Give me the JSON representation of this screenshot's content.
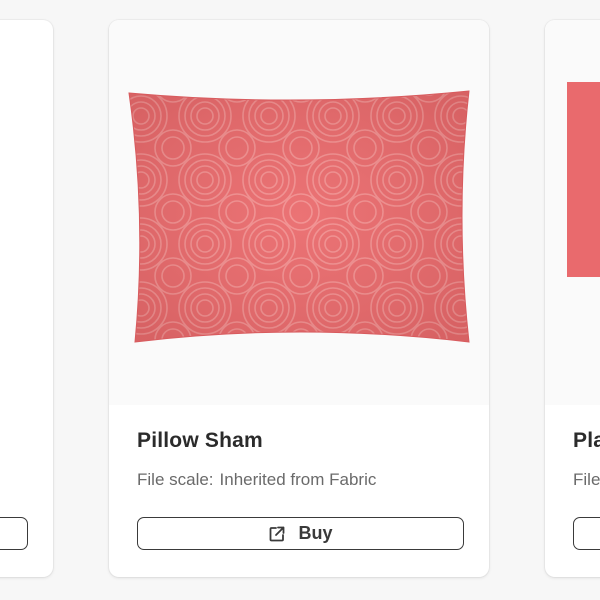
{
  "products": [
    {
      "title": "",
      "file_scale_label": "",
      "file_scale_value": "",
      "buy_label": ""
    },
    {
      "title": "Pillow Sham",
      "file_scale_label": "File scale:",
      "file_scale_value": "Inherited from Fabric",
      "buy_label": "Buy",
      "image_color": "#ea6a6c"
    },
    {
      "title": "Pla",
      "file_scale_label": "File",
      "buy_label": ""
    }
  ],
  "icons": {
    "buy": "external-link-icon"
  },
  "colors": {
    "page_bg": "#f7f7f7",
    "card_bg": "#ffffff",
    "button_border": "#3a3a3a",
    "product_pink": "#ea6a6c"
  }
}
